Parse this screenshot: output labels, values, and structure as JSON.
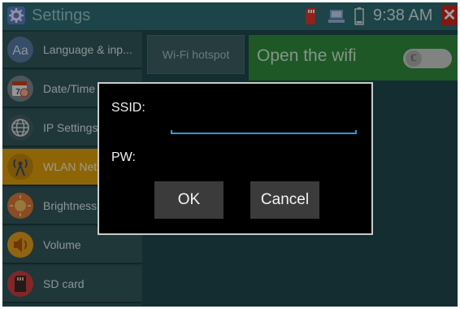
{
  "titlebar": {
    "title": "Settings",
    "time": "9:38 AM",
    "close_label": "✕",
    "icons": [
      "gear-icon",
      "sd-card-icon",
      "usb-icon",
      "battery-icon",
      "close-icon"
    ],
    "close_color": "#d0281c"
  },
  "sidebar": {
    "items": [
      {
        "label": "Language & inp...",
        "icon": "language-icon"
      },
      {
        "label": "Date/Time",
        "icon": "calendar-icon"
      },
      {
        "label": "IP Settings",
        "icon": "globe-icon"
      },
      {
        "label": "WLAN Net",
        "icon": "wifi-antenna-icon",
        "active": true
      },
      {
        "label": "Brightness",
        "icon": "brightness-icon"
      },
      {
        "label": "Volume",
        "icon": "speaker-icon"
      },
      {
        "label": "SD card",
        "icon": "sd-card-icon"
      }
    ],
    "active_color": "#e4a40c"
  },
  "main": {
    "hotspot_label": "Wi-Fi hotspot",
    "wifi_label": "Open the wifi",
    "wifi_enabled": false,
    "toggle_glyph": "ℂ"
  },
  "dialog": {
    "ssid_label": "SSID:",
    "ssid_value": "",
    "pw_label": "PW:",
    "pw_value": "",
    "ok_label": "OK",
    "cancel_label": "Cancel",
    "accent_color": "#2b9bd3"
  }
}
